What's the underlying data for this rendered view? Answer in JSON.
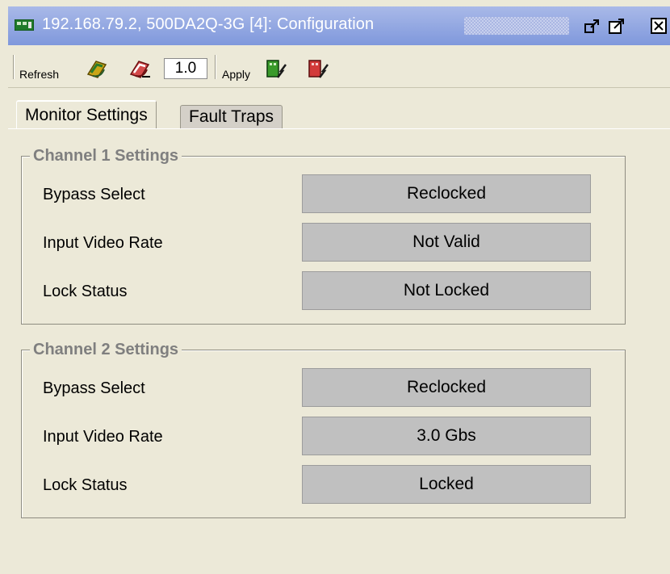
{
  "window": {
    "title": "192.168.79.2, 500DA2Q-3G  [4]: Configuration",
    "icons": [
      "card-icon",
      "undock-icon",
      "maximize-icon",
      "close-icon"
    ]
  },
  "toolbar": {
    "refresh_label": "Refresh",
    "version_value": "1.0",
    "apply_label": "Apply"
  },
  "tabs": [
    {
      "label": "Monitor Settings",
      "active": true
    },
    {
      "label": "Fault Traps",
      "active": false
    }
  ],
  "channels": [
    {
      "title": "Channel 1 Settings",
      "rows": [
        {
          "label": "Bypass Select",
          "value": "Reclocked"
        },
        {
          "label": "Input Video Rate",
          "value": "Not Valid"
        },
        {
          "label": "Lock Status",
          "value": "Not Locked"
        }
      ]
    },
    {
      "title": "Channel 2 Settings",
      "rows": [
        {
          "label": "Bypass Select",
          "value": "Reclocked"
        },
        {
          "label": "Input Video Rate",
          "value": "3.0 Gbs"
        },
        {
          "label": "Lock Status",
          "value": "Locked"
        }
      ]
    }
  ],
  "colors": {
    "titlebar": "#7f98dc",
    "background": "#ece9d8",
    "value_box": "#c0c0c0",
    "group_title": "#7f7f7f"
  }
}
